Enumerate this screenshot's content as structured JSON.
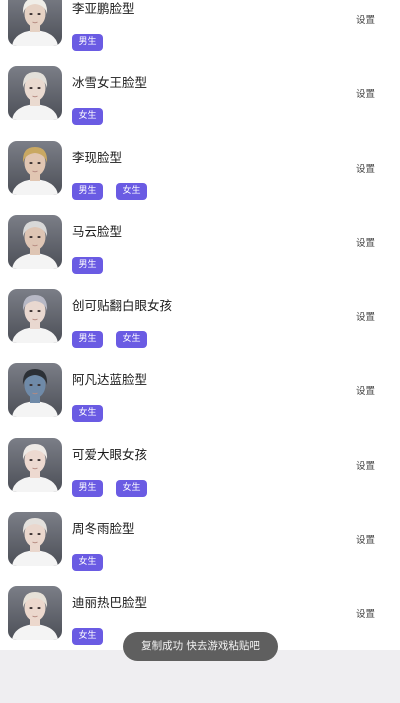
{
  "items": [
    {
      "name": "李亚鹏脸型",
      "hair": "#f0eee8",
      "skin": "#e6d2c4",
      "tags": [
        "男生"
      ],
      "setting": "设置"
    },
    {
      "name": "冰雪女王脸型",
      "hair": "#e3e0da",
      "skin": "#eadad0",
      "tags": [
        "女生"
      ],
      "setting": "设置"
    },
    {
      "name": "李现脸型",
      "hair": "#c9a862",
      "skin": "#e1c6b2",
      "tags": [
        "男生",
        "女生"
      ],
      "setting": "设置"
    },
    {
      "name": "马云脸型",
      "hair": "#d8d8d8",
      "skin": "#dec5b4",
      "tags": [
        "男生"
      ],
      "setting": "设置"
    },
    {
      "name": "创可贴翻白眼女孩",
      "hair": "#b7b8c5",
      "skin": "#e9d8d0",
      "tags": [
        "男生",
        "女生"
      ],
      "setting": "设置"
    },
    {
      "name": "阿凡达蓝脸型",
      "hair": "#2c3036",
      "skin": "#6f8aa8",
      "tags": [
        "女生"
      ],
      "setting": "设置"
    },
    {
      "name": "可爱大眼女孩",
      "hair": "#eeeae6",
      "skin": "#edd9d0",
      "tags": [
        "男生",
        "女生"
      ],
      "setting": "设置"
    },
    {
      "name": "周冬雨脸型",
      "hair": "#e4e1dd",
      "skin": "#ead7cd",
      "tags": [
        "女生"
      ],
      "setting": "设置"
    },
    {
      "name": "迪丽热巴脸型",
      "hair": "#e6e1d8",
      "skin": "#ecd8cd",
      "tags": [
        "女生"
      ],
      "setting": "设置"
    }
  ],
  "toast": "复制成功 快去游戏粘贴吧",
  "colors": {
    "tag_bg": "#6a5be3",
    "toast_bg": "#5f5f5f",
    "bottom_bar": "#efeef1"
  }
}
